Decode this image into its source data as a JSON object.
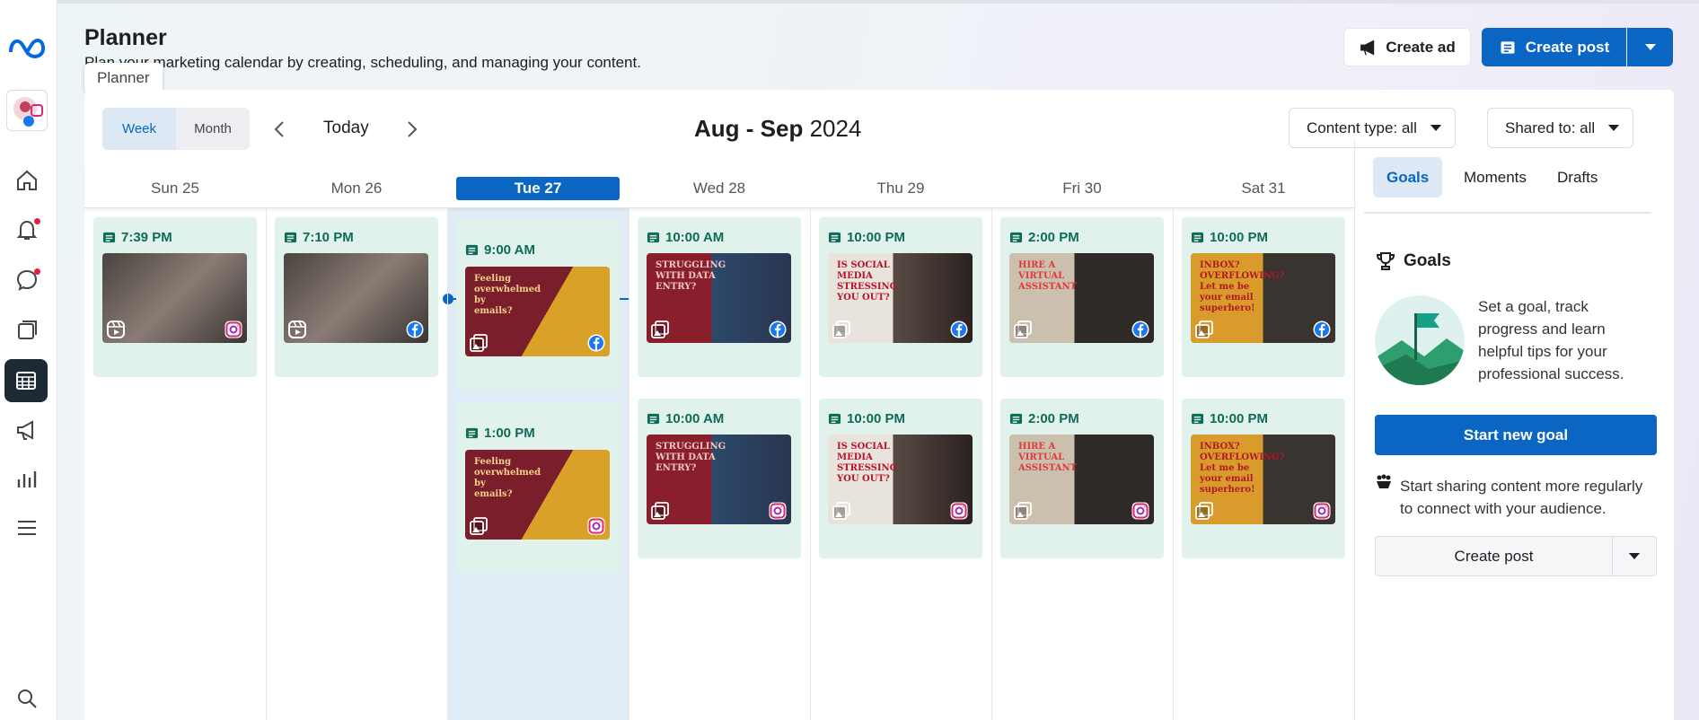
{
  "header": {
    "title": "Planner",
    "subtitle": "Plan your marketing calendar by creating, scheduling, and managing your content.",
    "tooltip": "Planner",
    "create_ad": "Create ad",
    "create_post": "Create post"
  },
  "toolbar": {
    "week": "Week",
    "month": "Month",
    "today": "Today",
    "range_months": "Aug - Sep",
    "range_year": "2024",
    "content_type": "Content type: all",
    "shared_to": "Shared to: all"
  },
  "days": [
    "Sun 25",
    "Mon 26",
    "Tue 27",
    "Wed 28",
    "Thu 29",
    "Fri 30",
    "Sat 31"
  ],
  "posts": [
    {
      "day": "Sun 25",
      "time": "7:39 PM",
      "network": "instagram",
      "media": "reel",
      "theme": "phone"
    },
    {
      "day": "Mon 26",
      "time": "7:10 PM",
      "network": "facebook",
      "media": "reel",
      "theme": "phone"
    },
    {
      "day": "Tue 27",
      "time": "9:00 AM",
      "network": "facebook",
      "media": "photo",
      "theme": "emails"
    },
    {
      "day": "Tue 27",
      "time": "1:00 PM",
      "network": "instagram",
      "media": "photo",
      "theme": "emails"
    },
    {
      "day": "Wed 28",
      "time": "10:00 AM",
      "network": "facebook",
      "media": "photo",
      "theme": "data"
    },
    {
      "day": "Wed 28",
      "time": "10:00 AM",
      "network": "instagram",
      "media": "photo",
      "theme": "data"
    },
    {
      "day": "Thu 29",
      "time": "10:00 PM",
      "network": "facebook",
      "media": "photo",
      "theme": "social"
    },
    {
      "day": "Thu 29",
      "time": "10:00 PM",
      "network": "instagram",
      "media": "photo",
      "theme": "social"
    },
    {
      "day": "Fri 30",
      "time": "2:00 PM",
      "network": "facebook",
      "media": "photo",
      "theme": "assistant"
    },
    {
      "day": "Fri 30",
      "time": "2:00 PM",
      "network": "instagram",
      "media": "photo",
      "theme": "assistant"
    },
    {
      "day": "Sat 31",
      "time": "10:00 PM",
      "network": "facebook",
      "media": "photo",
      "theme": "inbox"
    },
    {
      "day": "Sat 31",
      "time": "10:00 PM",
      "network": "instagram",
      "media": "photo",
      "theme": "inbox"
    }
  ],
  "thumb_text": {
    "emails": [
      "Feeling",
      "overwhelmed",
      "by",
      "emails?"
    ],
    "data": [
      "STRUGGLING",
      "WITH DATA",
      "ENTRY?"
    ],
    "social": [
      "IS SOCIAL",
      "MEDIA",
      "STRESSING",
      "YOU OUT?"
    ],
    "assistant": [
      "HIRE A",
      "VIRTUAL",
      "ASSISTANT"
    ],
    "inbox": [
      "INBOX?",
      "OVERFLOWING?",
      "Let me be",
      "your email",
      "superhero!"
    ]
  },
  "side": {
    "tabs": [
      "Goals",
      "Moments",
      "Drafts"
    ],
    "goals_title": "Goals",
    "goal_text": "Set a goal, track progress and learn helpful tips for your professional success.",
    "start_goal": "Start new goal",
    "share_text": "Start sharing content more regularly to connect with your audience.",
    "create_post": "Create post"
  },
  "colors": {
    "accent": "#0a66c2",
    "card_bg": "#e1f2ec",
    "time_text": "#0e6b57",
    "today_col": "#e1edf6"
  }
}
